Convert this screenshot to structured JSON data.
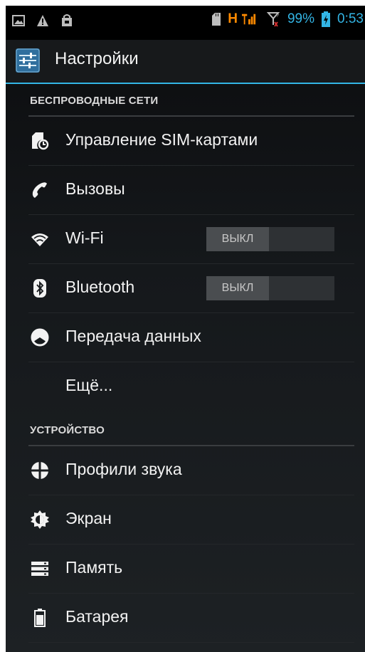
{
  "status_bar": {
    "network_type": "H",
    "battery_percent": "99%",
    "time": "0:53",
    "accent_color": "#33b5e5",
    "left_icons": [
      "picture-icon",
      "warning-icon",
      "shopping-bag-icon"
    ],
    "right_icons": [
      "sd-card-icon",
      "signal-icon",
      "no-sim-signal-icon",
      "battery-charging-icon"
    ]
  },
  "action_bar": {
    "title": "Настройки",
    "icon": "settings-sliders-icon"
  },
  "sections": {
    "wireless": {
      "header": "БЕСПРОВОДНЫЕ СЕТИ",
      "items": {
        "sim": {
          "label": "Управление SIM-картами",
          "icon": "sim-manage-icon"
        },
        "calls": {
          "label": "Вызовы",
          "icon": "phone-icon"
        },
        "wifi": {
          "label": "Wi-Fi",
          "icon": "wifi-icon",
          "toggle": "ВЫКЛ"
        },
        "bluetooth": {
          "label": "Bluetooth",
          "icon": "bluetooth-icon",
          "toggle": "ВЫКЛ"
        },
        "data": {
          "label": "Передача данных",
          "icon": "data-usage-icon"
        },
        "more": {
          "label": "Ещё..."
        }
      }
    },
    "device": {
      "header": "УСТРОЙСТВО",
      "items": {
        "sound": {
          "label": "Профили звука",
          "icon": "sound-profile-icon"
        },
        "display": {
          "label": "Экран",
          "icon": "brightness-icon"
        },
        "storage": {
          "label": "Память",
          "icon": "storage-icon"
        },
        "battery": {
          "label": "Батарея",
          "icon": "battery-icon"
        }
      }
    }
  }
}
